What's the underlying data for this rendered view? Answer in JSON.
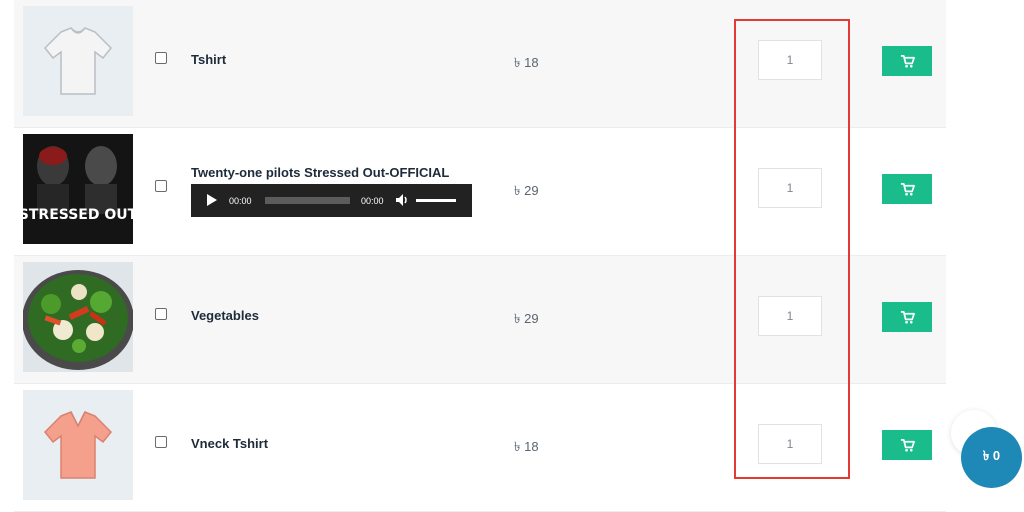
{
  "currency_symbol": "৳",
  "colors": {
    "cart_button": "#1abc8c",
    "floating_cart": "#1e88b6",
    "highlight_border": "#e53935"
  },
  "products": [
    {
      "name": "Tshirt",
      "price": "৳ 18",
      "quantity": "1",
      "icon": "white-tshirt-image"
    },
    {
      "name": "Twenty-one pilots Stressed Out-OFFICIAL",
      "price": "৳ 29",
      "quantity": "1",
      "icon": "stressed-out-album-image",
      "audio": {
        "current_time": "00:00",
        "duration": "00:00"
      }
    },
    {
      "name": "Vegetables",
      "price": "৳ 29",
      "quantity": "1",
      "icon": "vegetable-bowl-image"
    },
    {
      "name": "Vneck Tshirt",
      "price": "৳ 18",
      "quantity": "1",
      "icon": "pink-vneck-tshirt-image"
    }
  ],
  "image_text": {
    "album": "STRESSED OUT"
  },
  "cart_button_icon": "cart-icon",
  "floating_cart": {
    "label": "৳ 0"
  }
}
